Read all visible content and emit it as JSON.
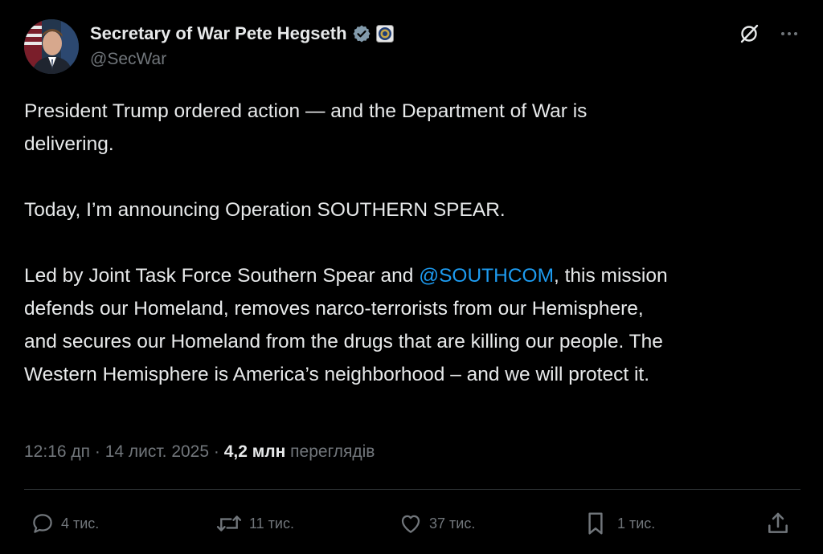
{
  "author": {
    "display_name": "Secretary of War Pete Hegseth",
    "handle": "@SecWar",
    "verified_icon": "verified-badge-icon",
    "affiliation_icon": "department-seal-icon"
  },
  "top_actions": {
    "grok_icon": "grok-icon",
    "more_icon": "more-icon"
  },
  "post": {
    "p1": "President Trump ordered action — and the Department of War is delivering.",
    "p1_line1": "President Trump ordered action — and the Department of War is",
    "p1_line2": "delivering.",
    "p2": "Today, I’m announcing Operation SOUTHERN SPEAR.",
    "p3_before": "Led by Joint Task Force Southern Spear and ",
    "p3_mention": "@SOUTHCOM",
    "p3_line1_after": ", this mission",
    "p3_line2": "defends our Homeland, removes narco-terrorists from our Hemisphere,",
    "p3_line3": "and secures our Homeland from the drugs that are killing our people. The",
    "p3_line4": "Western Hemisphere is America’s neighborhood – and we will protect it."
  },
  "meta": {
    "time": "12:16 дп",
    "separator": " · ",
    "date": "14 лист. 2025",
    "views_count": "4,2 млн",
    "views_label": "переглядів"
  },
  "actions": {
    "replies": "4 тис.",
    "reposts": "11 тис.",
    "likes": "37 тис.",
    "bookmarks": "1 тис."
  },
  "colors": {
    "background": "#000000",
    "text": "#e7e9ea",
    "secondary": "#71767b",
    "link": "#1d9bf0",
    "divider": "#2f3336"
  }
}
